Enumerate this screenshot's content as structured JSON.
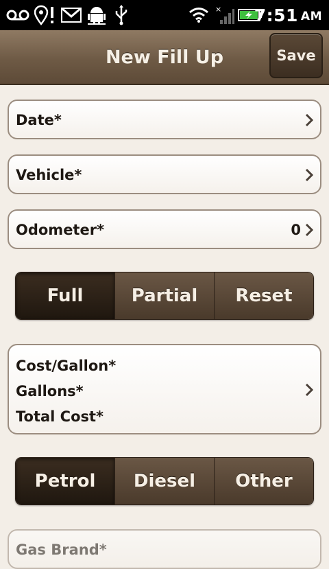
{
  "status_bar": {
    "time": "7:51",
    "ampm": "AM",
    "icons": [
      "voicemail-icon",
      "location-alert-icon",
      "gmail-icon",
      "android-debug-icon",
      "usb-icon",
      "wifi-icon",
      "no-signal-icon",
      "battery-charging-icon"
    ]
  },
  "header": {
    "title": "New Fill Up",
    "save_label": "Save"
  },
  "form": {
    "date_label": "Date*",
    "vehicle_label": "Vehicle*",
    "odometer_label": "Odometer*",
    "odometer_value": "0",
    "fill_type": {
      "options": [
        "Full",
        "Partial",
        "Reset"
      ],
      "selected": "Full"
    },
    "cost": {
      "cost_per_gallon_label": "Cost/Gallon*",
      "gallons_label": "Gallons*",
      "total_cost_label": "Total Cost*"
    },
    "fuel_type": {
      "options": [
        "Petrol",
        "Diesel",
        "Other"
      ],
      "selected": "Petrol"
    },
    "gas_brand_label": "Gas Brand*"
  },
  "colors": {
    "titlebar": "#6e5a45",
    "selected_segment": "#2a1f15",
    "segment": "#5a4836",
    "background": "#f3eee7"
  }
}
